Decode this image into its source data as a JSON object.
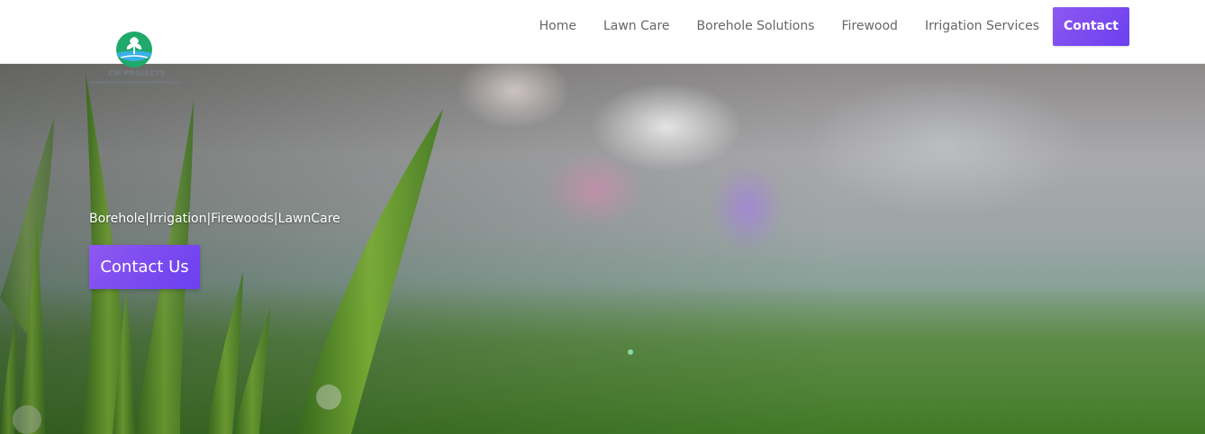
{
  "logo": {
    "text": "CM PROJECTS",
    "icon": "tree-water-logo-icon"
  },
  "nav": {
    "items": [
      {
        "label": "Home"
      },
      {
        "label": "Lawn Care"
      },
      {
        "label": "Borehole Solutions"
      },
      {
        "label": "Firewood"
      },
      {
        "label": "Irrigation Services"
      }
    ],
    "cta_label": "Contact"
  },
  "hero": {
    "tagline": "Borehole|Irrigation|Firewoods|LawnCare",
    "button_label": "Contact Us"
  },
  "colors": {
    "accent": "#7b4bf0",
    "nav_text": "#666666",
    "logo_green": "#1fa96a",
    "logo_blue": "#3ab0e6"
  }
}
